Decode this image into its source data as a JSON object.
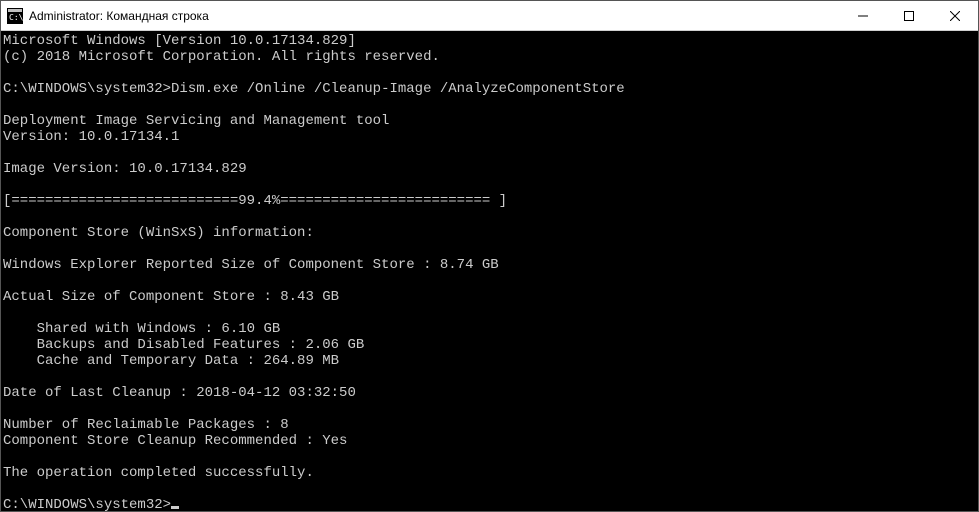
{
  "titlebar": {
    "title": "Administrator: Командная строка"
  },
  "terminal": {
    "line01": "Microsoft Windows [Version 10.0.17134.829]",
    "line02": "(c) 2018 Microsoft Corporation. All rights reserved.",
    "blank1": "",
    "prompt1_path": "C:\\WINDOWS\\system32>",
    "prompt1_cmd": "Dism.exe /Online /Cleanup-Image /AnalyzeComponentStore",
    "blank2": "",
    "line03": "Deployment Image Servicing and Management tool",
    "line04": "Version: 10.0.17134.1",
    "blank3": "",
    "line05": "Image Version: 10.0.17134.829",
    "blank4": "",
    "line06": "[===========================99.4%========================= ]",
    "blank5": "",
    "line07": "Component Store (WinSxS) information:",
    "blank6": "",
    "line08": "Windows Explorer Reported Size of Component Store : 8.74 GB",
    "blank7": "",
    "line09": "Actual Size of Component Store : 8.43 GB",
    "blank8": "",
    "line10": "    Shared with Windows : 6.10 GB",
    "line11": "    Backups and Disabled Features : 2.06 GB",
    "line12": "    Cache and Temporary Data : 264.89 MB",
    "blank9": "",
    "line13": "Date of Last Cleanup : 2018-04-12 03:32:50",
    "blank10": "",
    "line14": "Number of Reclaimable Packages : 8",
    "line15": "Component Store Cleanup Recommended : Yes",
    "blank11": "",
    "line16": "The operation completed successfully.",
    "blank12": "",
    "prompt2_path": "C:\\WINDOWS\\system32>"
  }
}
